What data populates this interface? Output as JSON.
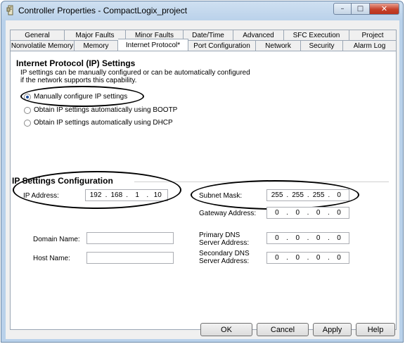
{
  "window": {
    "title": "Controller Properties - CompactLogix_project"
  },
  "caption_icons": {
    "minimize": "minimize-icon",
    "maximize": "maximize-icon",
    "close": "close-icon"
  },
  "tabs_row1": [
    "General",
    "Major Faults",
    "Minor Faults",
    "Date/Time",
    "Advanced",
    "SFC Execution",
    "Project"
  ],
  "tabs_row2": [
    "Nonvolatile Memory",
    "Memory",
    "Internet Protocol*",
    "Port Configuration",
    "Network",
    "Security",
    "Alarm Log"
  ],
  "active_tab": "Internet Protocol*",
  "ip_settings": {
    "heading": "Internet Protocol (IP) Settings",
    "description": "IP settings can be manually configured or can be automatically configured if the network supports this capability.",
    "options": [
      {
        "label": "Manually configure IP settings",
        "selected": true
      },
      {
        "label": "Obtain IP settings automatically using BOOTP",
        "selected": false
      },
      {
        "label": "Obtain IP settings automatically using DHCP",
        "selected": false
      }
    ]
  },
  "config": {
    "heading": "IP Settings Configuration",
    "ip_address": {
      "label": "IP Address:",
      "octets": [
        "192",
        "168",
        "1",
        "10"
      ]
    },
    "subnet_mask": {
      "label": "Subnet Mask:",
      "octets": [
        "255",
        "255",
        "255",
        "0"
      ]
    },
    "gateway": {
      "label": "Gateway Address:",
      "octets": [
        "0",
        "0",
        "0",
        "0"
      ]
    },
    "domain_name": {
      "label": "Domain Name:",
      "value": ""
    },
    "host_name": {
      "label": "Host Name:",
      "value": ""
    },
    "primary_dns": {
      "label": "Primary DNS Server Address:",
      "octets": [
        "0",
        "0",
        "0",
        "0"
      ]
    },
    "secondary_dns": {
      "label": "Secondary DNS Server Address:",
      "octets": [
        "0",
        "0",
        "0",
        "0"
      ]
    }
  },
  "buttons": {
    "ok": "OK",
    "cancel": "Cancel",
    "apply": "Apply",
    "help": "Help"
  },
  "colors": {
    "annotation": "#000000",
    "radio_selected": "#1e50a0",
    "close_button": "#c7422b"
  }
}
